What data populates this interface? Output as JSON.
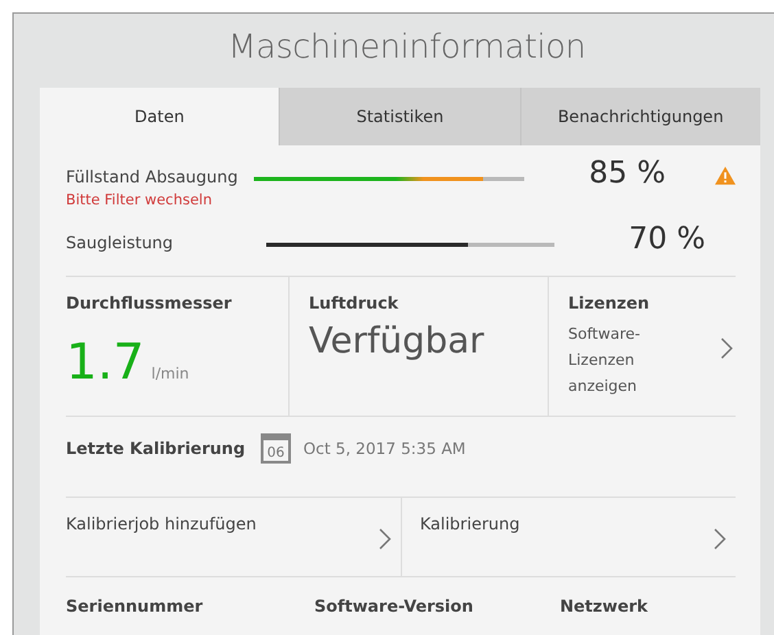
{
  "window": {
    "title": "Maschineninformation"
  },
  "tabs": [
    {
      "label": "Daten",
      "selected": true
    },
    {
      "label": "Statistiken",
      "selected": false
    },
    {
      "label": "Benachrichtigungen",
      "selected": false
    }
  ],
  "meters": [
    {
      "kind": "warning",
      "label": "Füllstand Absaugung",
      "hint": "Bitte Filter wechseln",
      "level": 0.85,
      "reading": "85 %"
    },
    {
      "kind": "normal",
      "label": "Saugleistung",
      "level": 0.7,
      "reading": "70 %"
    }
  ],
  "tiles": [
    {
      "kind": "value",
      "label": "Durchflussmesser",
      "value": "1.7",
      "unit": "l/min"
    },
    {
      "kind": "status",
      "label": "Luftdruck",
      "value": "Verfügbar"
    },
    {
      "kind": "link",
      "label": "Lizenzen",
      "value": "Software-Lizenzen anzeigen"
    }
  ],
  "calibration": {
    "label": "Letzte Kalibrierung",
    "day": "06",
    "date": "Oct 5, 2017 5:35 AM"
  },
  "actions": [
    {
      "label": "Kalibrierjob hinzufügen"
    },
    {
      "label": "Kalibrierung"
    }
  ],
  "info_columns": [
    "Seriennummer",
    "Software-Version",
    "Netzwerk"
  ]
}
